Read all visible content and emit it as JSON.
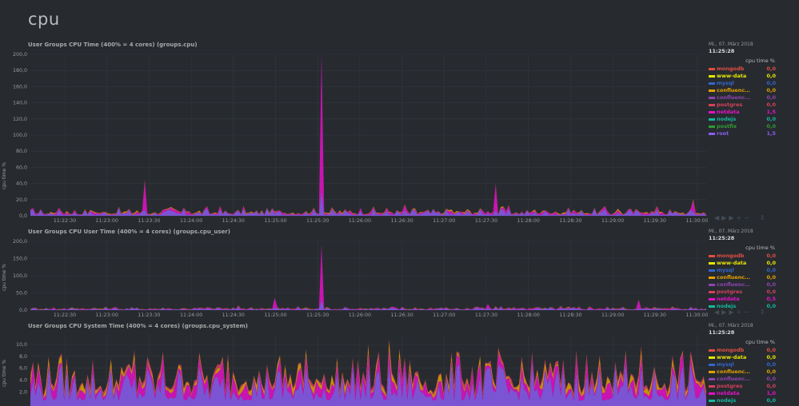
{
  "page": {
    "title": "cpu"
  },
  "colors": {
    "background": "#272b30",
    "grid": "#33383e",
    "mongodb": "#e24d42",
    "www-data": "#e5e500",
    "mysql": "#3366cc",
    "confluence1": "#e5a100",
    "confluence2": "#8e44ad",
    "postgres": "#d6405b",
    "netdata": "#e511c8",
    "nodejs": "#14b89c",
    "postfix": "#339933",
    "root": "#8a5cf0"
  },
  "charts": [
    {
      "id": "cpu",
      "title": "User Groups CPU Time (400% = 4 cores) (groups.cpu)",
      "ylabel": "cpu time %",
      "yticks": [
        "200,0",
        "180,0",
        "160,0",
        "140,0",
        "120,0",
        "100,0",
        "80,0",
        "60,0",
        "40,0",
        "20,0",
        "0,0"
      ],
      "xticks": [
        "11:22:30",
        "11:23:00",
        "11:23:30",
        "11:24:00",
        "11:24:30",
        "11:25:00",
        "11:25:30",
        "11:26:00",
        "11:26:30",
        "11:27:00",
        "11:27:30",
        "11:28:00",
        "11:28:30",
        "11:29:00",
        "11:29:30",
        "11:30:00"
      ],
      "legend": {
        "date": "Mi., 07. März 2018",
        "time": "11:25:28",
        "units": "cpu time %",
        "rows": [
          {
            "name": "mongodb",
            "value": "0,0",
            "color": "#e24d42"
          },
          {
            "name": "www-data",
            "value": "0,0",
            "color": "#e5e500"
          },
          {
            "name": "mysql",
            "value": "0,0",
            "color": "#3366cc"
          },
          {
            "name": "confluenc...",
            "value": "0,0",
            "color": "#e5a100"
          },
          {
            "name": "confluenc...",
            "value": "0,0",
            "color": "#8e44ad"
          },
          {
            "name": "postgres",
            "value": "0,0",
            "color": "#d6405b"
          },
          {
            "name": "netdata",
            "value": "1,5",
            "color": "#e511c8"
          },
          {
            "name": "nodejs",
            "value": "0,0",
            "color": "#14b89c"
          },
          {
            "name": "postfix",
            "value": "0,0",
            "color": "#339933"
          },
          {
            "name": "root",
            "value": "1,5",
            "color": "#8a5cf0"
          }
        ]
      }
    },
    {
      "id": "cpu_user",
      "title": "User Groups CPU User Time (400% = 4 cores) (groups.cpu_user)",
      "ylabel": "cpu time %",
      "yticks": [
        "200,0",
        "150,0",
        "100,0",
        "50,0",
        "0,0"
      ],
      "xticks": [
        "11:22:30",
        "11:23:00",
        "11:23:30",
        "11:24:00",
        "11:24:30",
        "11:25:00",
        "11:25:30",
        "11:26:00",
        "11:26:30",
        "11:27:00",
        "11:27:30",
        "11:28:00",
        "11:28:30",
        "11:29:00",
        "11:29:30",
        "11:30:00"
      ],
      "legend": {
        "date": "Mi., 07. März 2018",
        "time": "11:25:28",
        "units": "cpu time %",
        "rows": [
          {
            "name": "mongodb",
            "value": "0,0",
            "color": "#e24d42"
          },
          {
            "name": "www-data",
            "value": "0,0",
            "color": "#e5e500"
          },
          {
            "name": "mysql",
            "value": "0,0",
            "color": "#3366cc"
          },
          {
            "name": "confluenc...",
            "value": "0,0",
            "color": "#e5a100"
          },
          {
            "name": "confluenc...",
            "value": "0,0",
            "color": "#8e44ad"
          },
          {
            "name": "postgres",
            "value": "0,0",
            "color": "#d6405b"
          },
          {
            "name": "netdata",
            "value": "0,5",
            "color": "#e511c8"
          },
          {
            "name": "nodejs",
            "value": "0,0",
            "color": "#14b89c"
          }
        ]
      }
    },
    {
      "id": "cpu_system",
      "title": "User Groups CPU System Time (400% = 4 cores) (groups.cpu_system)",
      "ylabel": "cpu time %",
      "yticks": [
        "10,0",
        "8,0",
        "6,0",
        "4,0",
        "2,0"
      ],
      "xticks": [],
      "legend": {
        "date": "Mi., 07. März 2018",
        "time": "11:25:28",
        "units": "cpu time %",
        "rows": [
          {
            "name": "mongodb",
            "value": "0,0",
            "color": "#e24d42"
          },
          {
            "name": "www-data",
            "value": "0,0",
            "color": "#e5e500"
          },
          {
            "name": "mysql",
            "value": "0,0",
            "color": "#3366cc"
          },
          {
            "name": "confluenc...",
            "value": "0,0",
            "color": "#e5a100"
          },
          {
            "name": "confluenc...",
            "value": "0,0",
            "color": "#8e44ad"
          },
          {
            "name": "postgres",
            "value": "0,0",
            "color": "#d6405b"
          },
          {
            "name": "netdata",
            "value": "1,0",
            "color": "#e511c8"
          },
          {
            "name": "nodejs",
            "value": "0,0",
            "color": "#14b89c"
          }
        ]
      }
    }
  ],
  "toolbar": {
    "icons": [
      "left-arrow-icon",
      "right-arrow-icon",
      "fast-forward-icon",
      "zoom-in-icon",
      "zoom-out-icon",
      "resize-icon"
    ]
  }
}
